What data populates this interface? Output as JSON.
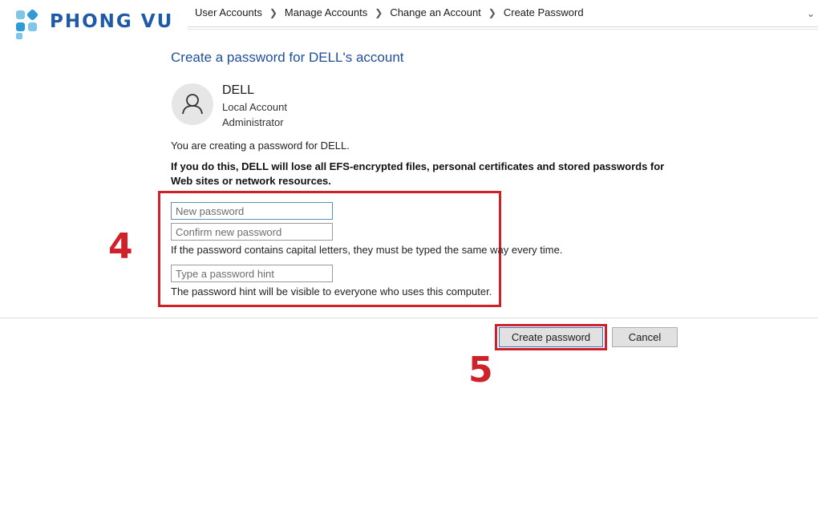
{
  "logo": {
    "text": "PHONG VU",
    "colors": {
      "light": "#7fc7ea",
      "main": "#2f9bd6"
    }
  },
  "breadcrumb": {
    "items": [
      "User Accounts",
      "Manage Accounts",
      "Change an Account",
      "Create Password"
    ],
    "separator_icon": "chevron-right-icon",
    "dropdown_icon": "chevron-down-icon"
  },
  "heading": "Create a password for DELL's account",
  "account": {
    "name": "DELL",
    "type": "Local Account",
    "role": "Administrator",
    "avatar_icon": "user-icon"
  },
  "intro": "You are creating a password for DELL.",
  "warning": "If you do this, DELL will lose all EFS-encrypted files, personal certificates and stored passwords for Web sites or network resources.",
  "form": {
    "new_password_placeholder": "New password",
    "confirm_password_placeholder": "Confirm new password",
    "capital_note": "If the password contains capital letters, they must be typed the same way every time.",
    "hint_placeholder": "Type a password hint",
    "hint_note": "The password hint will be visible to everyone who uses this computer."
  },
  "buttons": {
    "create": "Create password",
    "cancel": "Cancel"
  },
  "annotations": {
    "step_form": "4",
    "step_button": "5",
    "highlight_color": "#d0202a"
  }
}
